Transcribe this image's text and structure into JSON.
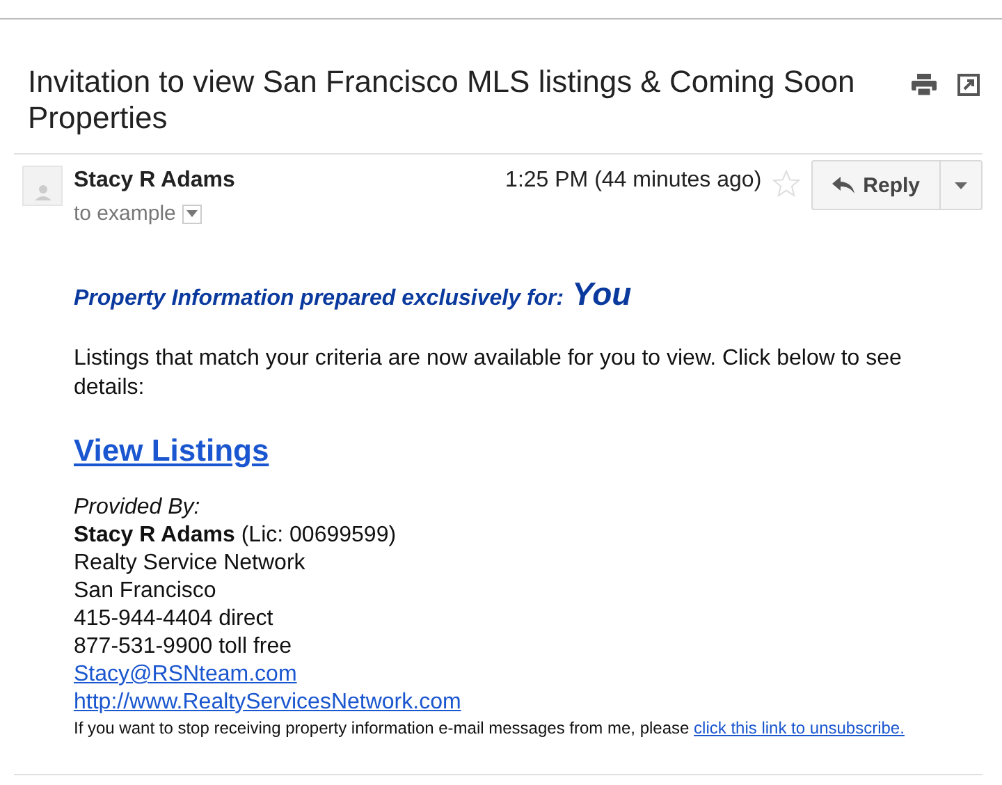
{
  "subject": "Invitation to view San Francisco MLS listings & Coming Soon Properties",
  "message": {
    "sender": "Stacy R Adams",
    "recipients": "to example",
    "time": "1:25 PM (44 minutes ago)",
    "starred": false,
    "reply_label": "Reply"
  },
  "body": {
    "heading": "Property Information prepared exclusively for:",
    "recipient": "You",
    "intro": "Listings that match your criteria are now available for you to view. Click below to see details:",
    "cta": "View Listings",
    "signature": [
      {
        "kind": "label",
        "text": "Provided By:"
      },
      {
        "kind": "text",
        "text": "**Stacy R Adams** (Lic: 00699599)"
      },
      {
        "kind": "text",
        "text": "Realty Service Network"
      },
      {
        "kind": "text",
        "text": "San Francisco"
      },
      {
        "kind": "text",
        "text": "415-944-4404 direct"
      },
      {
        "kind": "text",
        "text": "877-531-9900 toll free"
      },
      {
        "kind": "link",
        "text": "Stacy@RSNteam.com"
      },
      {
        "kind": "link",
        "text": "http://www.RealtyServicesNetwork.com"
      }
    ],
    "unsubscribe": {
      "text": "If you want to stop receiving property information e-mail messages from me, please",
      "link": "click this link to unsubscribe."
    }
  }
}
